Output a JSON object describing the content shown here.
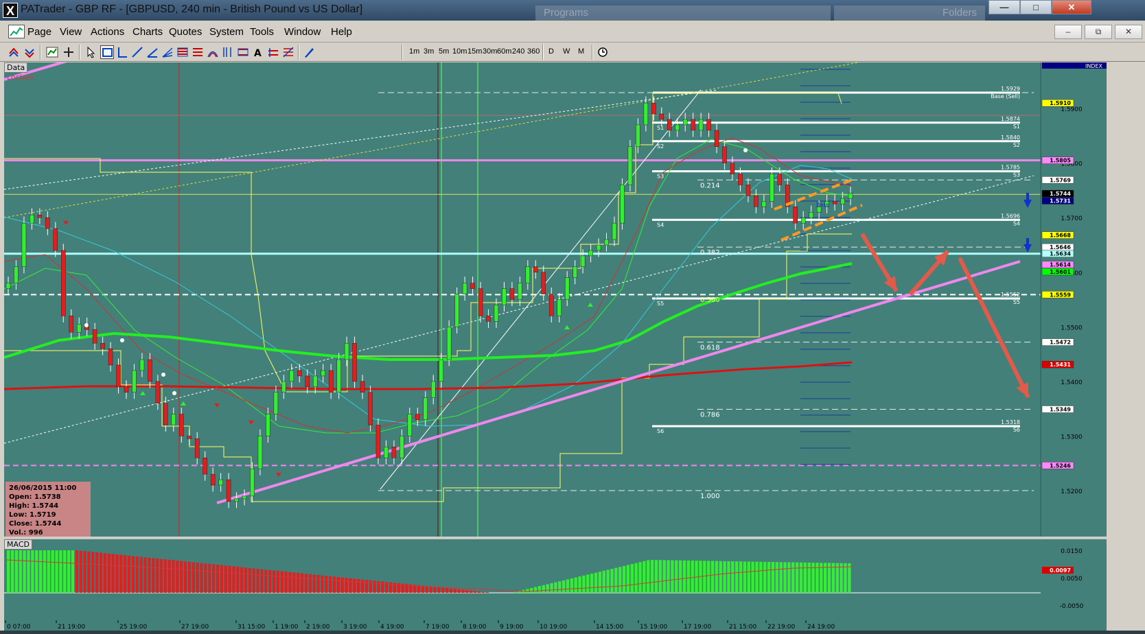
{
  "window": {
    "title": "PATrader - GBP RF - [GBPUSD, 240 min - British Pound vs US Dollar]",
    "bg_tabs": [
      "Programs",
      "Folders"
    ],
    "minimize": "—",
    "maximize": "□",
    "close": "✕"
  },
  "menu": {
    "items": [
      "Page",
      "View",
      "Actions",
      "Charts",
      "Quotes",
      "System",
      "Tools",
      "Window",
      "Help"
    ],
    "mdi_min": "–",
    "mdi_restore": "⧉",
    "mdi_close": "✕"
  },
  "toolbar": {
    "timeframes": [
      "1m",
      "3m",
      "5m",
      "10m",
      "15m",
      "30m",
      "60m",
      "240",
      "360"
    ],
    "periods": [
      "D",
      "W",
      "M"
    ]
  },
  "chart": {
    "data_label": "Data",
    "locked_label": "Locked",
    "index_label": "INDEX",
    "ohlc": {
      "date": "26/06/2015 11:00",
      "open": "Open: 1.5738",
      "high": "High: 1.5744",
      "low": "Low: 1.5719",
      "close": "Close: 1.5744",
      "vol": "Vol.: 996"
    },
    "price_axis": [
      "1.5900",
      "1.5800",
      "1.5700",
      "1.5600",
      "1.5500",
      "1.5400",
      "1.5300",
      "1.5200"
    ],
    "price_tags": [
      {
        "label": "1.5910",
        "bg": "#ffff00",
        "fg": "#000000"
      },
      {
        "label": "1.5805",
        "bg": "#ff88ff",
        "fg": "#000000"
      },
      {
        "label": "1.5769",
        "bg": "#ffffff",
        "fg": "#000000"
      },
      {
        "label": "1.5744",
        "bg": "#000000",
        "fg": "#ffffff"
      },
      {
        "label": "1.5731",
        "bg": "#000080",
        "fg": "#ffffff"
      },
      {
        "label": "1.5668",
        "bg": "#ffff00",
        "fg": "#000000"
      },
      {
        "label": "1.5646",
        "bg": "#ffffff",
        "fg": "#000000"
      },
      {
        "label": "1.5634",
        "bg": "#b0ffff",
        "fg": "#000000"
      },
      {
        "label": "1.5614",
        "bg": "#ff88ff",
        "fg": "#000000"
      },
      {
        "label": "1.5601",
        "bg": "#00ff00",
        "fg": "#000000"
      },
      {
        "label": "1.5559",
        "bg": "#ffff00",
        "fg": "#000000"
      },
      {
        "label": "1.5472",
        "bg": "#ffffff",
        "fg": "#000000"
      },
      {
        "label": "1.5431",
        "bg": "#dd0000",
        "fg": "#ffffff"
      },
      {
        "label": "1.5349",
        "bg": "#ffffff",
        "fg": "#000000"
      },
      {
        "label": "1.5246",
        "bg": "#ff88ff",
        "fg": "#000000"
      }
    ],
    "levels": [
      {
        "price": "1.5929",
        "tag": "Base (Sell)"
      },
      {
        "price": "1.5874",
        "tag": "S1"
      },
      {
        "price": "1.5840",
        "tag": "S2"
      },
      {
        "price": "1.5785",
        "tag": "S3"
      },
      {
        "price": "1.5696",
        "tag": "S4"
      },
      {
        "price": "1.5552",
        "tag": "S5"
      },
      {
        "price": "1.5318",
        "tag": "S6"
      }
    ],
    "left_tags": [
      "S1",
      "S2",
      "S3",
      "S4",
      "S5",
      "S6"
    ],
    "fib": [
      "0.214",
      "0.382",
      "0.500",
      "0.618",
      "0.786",
      "1.000"
    ],
    "base_small": "Base",
    "macd_label": "MACD",
    "macd_axis": [
      "0.0150",
      "0.0050",
      "-0.0050"
    ],
    "macd_tag": "0.0097",
    "time_labels": [
      "0 07:00",
      "21 19:00",
      "25 19:00",
      "27 19:00",
      "31 15:00",
      "1 19:00",
      "2 19:00",
      "3 19:00",
      "4 19:00",
      "7 19:00",
      "8 19:00",
      "9 19:00",
      "10 19:00",
      "14 15:00",
      "15 19:00",
      "17 19:00",
      "21 15:00",
      "22 19:00",
      "24 19:00"
    ]
  },
  "colors": {
    "chart_bg": "#44807a",
    "bull": "#33ee33",
    "bear": "#e02020",
    "trend": "#ee88ee",
    "arrow": "#e25a4a"
  }
}
